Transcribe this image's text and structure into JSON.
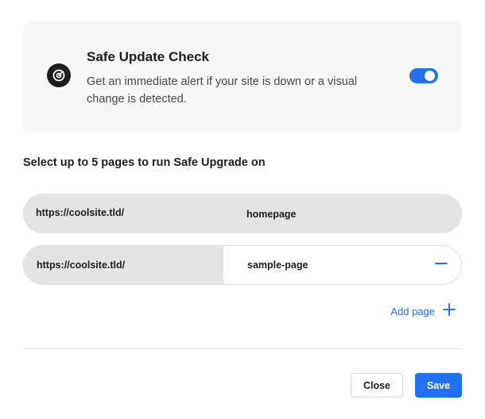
{
  "card": {
    "icon": "target-gauge-icon",
    "title": "Safe Update Check",
    "description": "Get an immediate alert if your site is down or a visual change is detected.",
    "toggle_on": true
  },
  "section": {
    "title": "Select up to 5 pages to run Safe Upgrade on"
  },
  "pages": [
    {
      "prefix": "https://coolsite.tld/",
      "slug": "homepage",
      "removable": false
    },
    {
      "prefix": "https://coolsite.tld/",
      "slug": "sample-page",
      "removable": true,
      "remove_icon": "minus-icon"
    }
  ],
  "add_page": {
    "label": "Add page",
    "icon": "plus-icon"
  },
  "footer": {
    "close_label": "Close",
    "save_label": "Save"
  },
  "colors": {
    "accent": "#2271f0",
    "card_bg": "#f7f7f7",
    "field_bg": "#e4e4e4",
    "text": "#1e1e1e"
  }
}
